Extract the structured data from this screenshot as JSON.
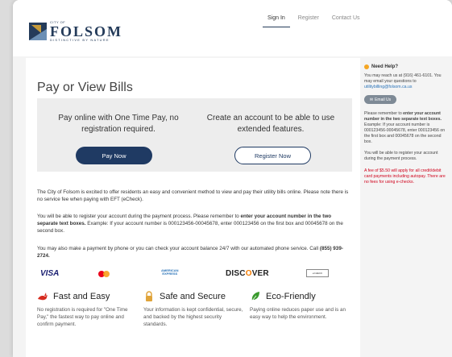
{
  "header": {
    "logo_city": "CITY OF",
    "logo_name": "FOLSOM",
    "logo_tag": "DISTINCTIVE BY NATURE",
    "nav": [
      "Sign In",
      "Register",
      "Contact Us"
    ]
  },
  "main": {
    "title": "Pay or View Bills",
    "cta_left": "Pay online with One Time Pay, no registration required.",
    "cta_right": "Create an account to be able to use extended features.",
    "pay_now": "Pay Now",
    "register_now": "Register Now",
    "para1": "The City of Folsom is excited to offer residents an easy and convenient method to view and pay their utility bills online. Please note there is no service fee when paying with EFT (eCheck).",
    "para2_a": "You will be able to register your account during the payment process.  Please remember to ",
    "para2_b": "enter your account number in the two separate text boxes.",
    "para2_c": " Example: If your account number is 000123456-00045678, enter 000123456 on the first box and 00045678 on the second box.",
    "para3_a": "You may also make a payment by phone or you can check your account balance 24/7 with our automated phone service. Call ",
    "para3_b": "(855) 939-2724.",
    "cards": {
      "visa": "VISA",
      "amex_1": "AMERICAN",
      "amex_2": "EXPRESS",
      "discover_a": "DISC",
      "discover_o": "O",
      "discover_b": "VER",
      "echeck": "eCHECK"
    },
    "features": [
      {
        "title": "Fast and Easy",
        "desc": "No registration is required for \"One Time Pay,\" the fastest way to pay online and confirm payment."
      },
      {
        "title": "Safe and Secure",
        "desc": "Your information is kept confidential, secure, and backed by the highest security standards."
      },
      {
        "title": "Eco-Friendly",
        "desc": "Paying online reduces paper use and is an easy way to help the environment."
      }
    ]
  },
  "sidebar": {
    "help_title": "Need Help?",
    "help_text": "You may reach us at (916) 461-6101. You may email your questions to ",
    "help_email": "utilitybilling@folsom.ca.us",
    "email_button": "Email Us",
    "reminder_a": "Please remember to ",
    "reminder_b": "enter your account number in the two separate text boxes.",
    "reminder_c": " Example: If your account number is 000123456-00045678, enter 000123456 on the first box and 00045678 on the second box.",
    "register_note": "You will be able to register your account during the payment process.",
    "fee_note": "A fee of $5.50 will apply for all credit/debit card payments including autopay. There are no fees for using e-checks."
  },
  "colors": {
    "primary": "#1f3a63",
    "fee_text": "#d0021b",
    "eco_green": "#3a9a2e",
    "fast_red": "#d62b1f",
    "safe_gold": "#e0a43a"
  }
}
